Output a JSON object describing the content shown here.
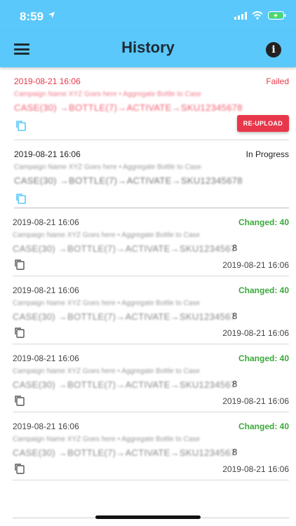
{
  "statusbar": {
    "time": "8:59",
    "location_icon": "location-arrow-icon"
  },
  "header": {
    "title": "History",
    "menu_icon": "hamburger-menu-icon",
    "info_icon": "info-icon"
  },
  "items": [
    {
      "timestamp": "2019-08-21 16:06",
      "status": "Failed",
      "status_type": "failed",
      "line1": "Campaign Name XYZ Goes here • Aggregate Bottle to Case",
      "line2": "CASE(30) →BOTTLE(7)→ACTIVATE→SKU12345678",
      "action_label": "RE-UPLOAD"
    },
    {
      "timestamp": "2019-08-21 16:06",
      "status": "In Progress",
      "status_type": "progress",
      "line1": "Campaign Name XYZ Goes here • Aggregate Bottle to Case",
      "line2": "CASE(30) →BOTTLE(7)→ACTIVATE→SKU12345678"
    },
    {
      "timestamp": "2019-08-21 16:06",
      "status": "Changed: 40",
      "status_type": "changed",
      "line1": "Campaign Name XYZ Goes here • Aggregate Bottle to Case",
      "line2": "CASE(30) →BOTTLE(7)→ACTIVATE→SKU1234567",
      "line2_tail": "8",
      "completed": "2019-08-21 16:06"
    },
    {
      "timestamp": "2019-08-21 16:06",
      "status": "Changed: 40",
      "status_type": "changed",
      "line1": "Campaign Name XYZ Goes here • Aggregate Bottle to Case",
      "line2": "CASE(30) →BOTTLE(7)→ACTIVATE→SKU1234567",
      "line2_tail": "8",
      "completed": "2019-08-21 16:06"
    },
    {
      "timestamp": "2019-08-21 16:06",
      "status": "Changed: 40",
      "status_type": "changed",
      "line1": "Campaign Name XYZ Goes here • Aggregate Bottle to Case",
      "line2": "CASE(30) →BOTTLE(7)→ACTIVATE→SKU1234567",
      "line2_tail": "8",
      "completed": "2019-08-21 16:06"
    },
    {
      "timestamp": "2019-08-21 16:06",
      "status": "Changed: 40",
      "status_type": "changed",
      "line1": "Campaign Name XYZ Goes here • Aggregate Bottle to Case",
      "line2": "CASE(30) →BOTTLE(7)→ACTIVATE→SKU1234567",
      "line2_tail": "8",
      "completed": "2019-08-21 16:06"
    }
  ],
  "colors": {
    "header_bg": "#5ac8fa",
    "failed": "#e8374a",
    "changed": "#3aa83a",
    "copy_icon_active": "#5ac8fa",
    "copy_icon_inactive": "#555555"
  }
}
